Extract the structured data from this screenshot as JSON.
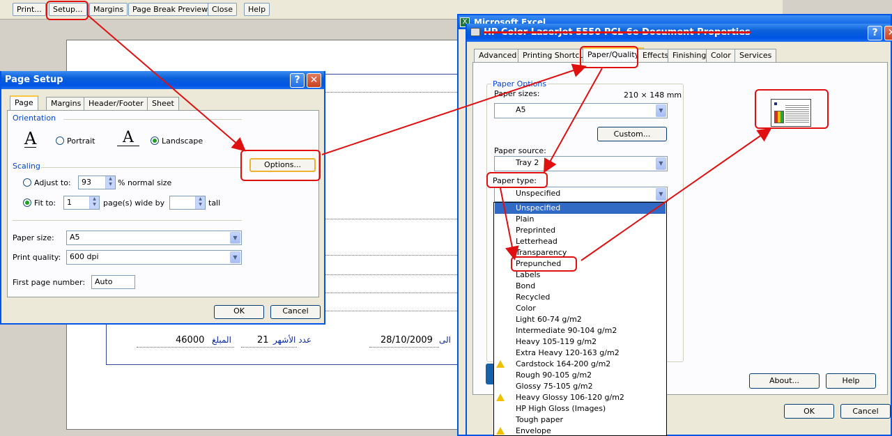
{
  "toolbar": {
    "print": "Print...",
    "setup": "Setup...",
    "margins": "Margins",
    "page_break": "Page Break Preview",
    "close": "Close",
    "help": "Help"
  },
  "sheet": {
    "row1": [
      "46000",
      "المبلغ",
      "21",
      "عدد الأشهر",
      "28/10/2009",
      "الى"
    ]
  },
  "page_setup": {
    "title": "Page Setup",
    "help_btn": "?",
    "close_btn": "✕",
    "tabs": [
      "Page",
      "Margins",
      "Header/Footer",
      "Sheet"
    ],
    "orientation": "Orientation",
    "portrait": "Portrait",
    "landscape": "Landscape",
    "scaling": "Scaling",
    "adjust_to": "Adjust to:",
    "adjust_value": "93",
    "normal_size": "% normal size",
    "fit_to": "Fit to:",
    "fit_wide": "1",
    "pages_wide_by": "page(s) wide by",
    "tall": "tall",
    "paper_size_label": "Paper size:",
    "paper_size": "A5",
    "print_quality_label": "Print quality:",
    "print_quality": "600 dpi",
    "first_page_label": "First page number:",
    "first_page": "Auto",
    "options": "Options...",
    "ok": "OK",
    "cancel": "Cancel"
  },
  "printer": {
    "behind_title": "Microsoft Excel",
    "title": "HP Color LaserJet 5550 PCL 6e Document Properties",
    "help_btn": "?",
    "close_btn": "✕",
    "tabs": [
      "Advanced",
      "Printing Shortcuts",
      "Paper/Quality",
      "Effects",
      "Finishing",
      "Color",
      "Services"
    ],
    "paper_options": "Paper Options",
    "paper_sizes_label": "Paper sizes:",
    "paper_dims": "210 × 148 mm",
    "paper_size": "A5",
    "custom": "Custom...",
    "paper_source_label": "Paper source:",
    "paper_source": "Tray 2",
    "paper_type_label": "Paper type:",
    "paper_type": "Unspecified",
    "type_options": [
      {
        "label": "Unspecified",
        "warn": false
      },
      {
        "label": "Plain",
        "warn": false
      },
      {
        "label": "Preprinted",
        "warn": false
      },
      {
        "label": "Letterhead",
        "warn": false
      },
      {
        "label": "Transparency",
        "warn": false
      },
      {
        "label": "Prepunched",
        "warn": false
      },
      {
        "label": "Labels",
        "warn": false
      },
      {
        "label": "Bond",
        "warn": false
      },
      {
        "label": "Recycled",
        "warn": false
      },
      {
        "label": "Color",
        "warn": false
      },
      {
        "label": "Light 60-74 g/m2",
        "warn": false
      },
      {
        "label": "Intermediate 90-104 g/m2",
        "warn": false
      },
      {
        "label": "Heavy 105-119 g/m2",
        "warn": false
      },
      {
        "label": "Extra Heavy 120-163 g/m2",
        "warn": false
      },
      {
        "label": "Cardstock 164-200 g/m2",
        "warn": true
      },
      {
        "label": "Rough 90-105 g/m2",
        "warn": false
      },
      {
        "label": "Glossy 75-105 g/m2",
        "warn": false
      },
      {
        "label": "Heavy Glossy 106-120 g/m2",
        "warn": true
      },
      {
        "label": "HP High Gloss (Images)",
        "warn": false
      },
      {
        "label": "Tough paper",
        "warn": false
      },
      {
        "label": "Envelope",
        "warn": true
      }
    ],
    "about": "About...",
    "help": "Help",
    "ok": "OK",
    "cancel": "Cancel"
  },
  "colors": {
    "annotation": "#e01010",
    "xp_blue": "#0055e5",
    "selection": "#316ac5"
  },
  "icons": {
    "portrait": "letter-A-icon",
    "landscape": "letter-A-icon",
    "preview": "page-preview-icon",
    "warning": "warning-icon",
    "printer": "printer-icon"
  }
}
